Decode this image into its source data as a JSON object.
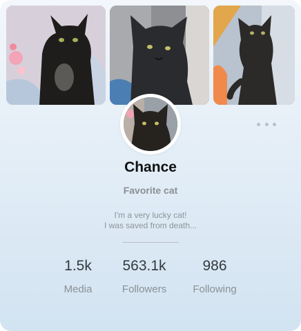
{
  "profile": {
    "name": "Chance",
    "subtitle": "Favorite cat",
    "bio_line1": "I'm a very lucky cat!",
    "bio_line2": "I was saved from death..."
  },
  "stats": [
    {
      "value": "1.5k",
      "label": "Media"
    },
    {
      "value": "563.1k",
      "label": "Followers"
    },
    {
      "value": "986",
      "label": "Following"
    }
  ],
  "icons": {
    "more": "more-horizontal-icon"
  },
  "colors": {
    "accent_bg": "#d2e3f1",
    "text_primary": "#111111",
    "text_muted": "#8a8f94"
  }
}
